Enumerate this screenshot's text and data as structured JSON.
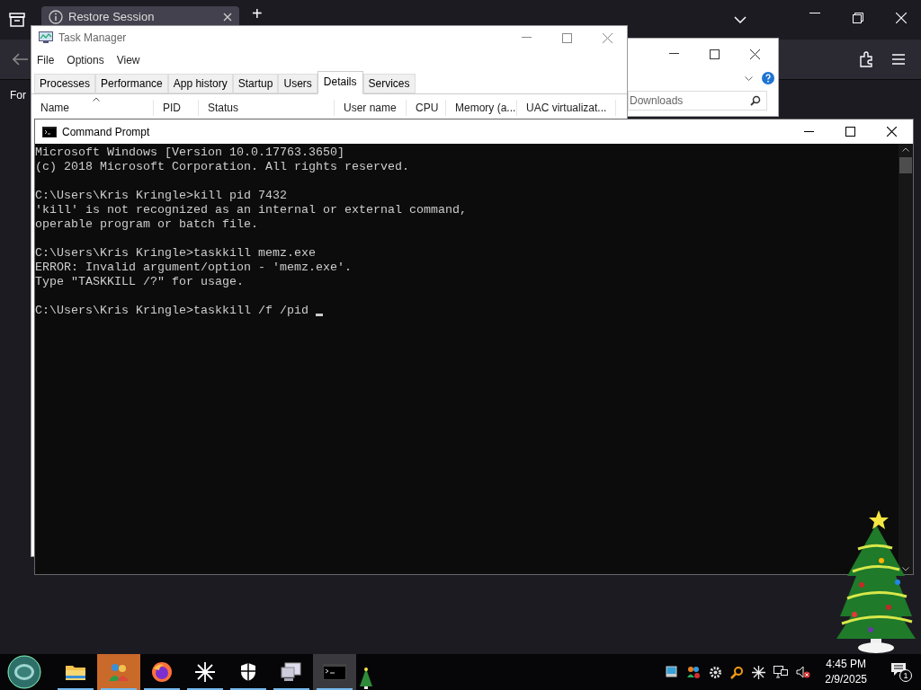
{
  "browser": {
    "tab": {
      "title": "Restore Session",
      "selected": true
    },
    "new_tab": "+",
    "page_text": "For"
  },
  "explorer": {
    "search": {
      "placeholder": "Downloads"
    }
  },
  "task_manager": {
    "title": "Task Manager",
    "menu": [
      "File",
      "Options",
      "View"
    ],
    "tabs": [
      {
        "label": "Processes",
        "selected": false
      },
      {
        "label": "Performance",
        "selected": false
      },
      {
        "label": "App history",
        "selected": false
      },
      {
        "label": "Startup",
        "selected": false
      },
      {
        "label": "Users",
        "selected": false
      },
      {
        "label": "Details",
        "selected": true
      },
      {
        "label": "Services",
        "selected": false
      }
    ],
    "columns": [
      "Name",
      "PID",
      "Status",
      "User name",
      "CPU",
      "Memory (a...",
      "UAC virtualizat..."
    ]
  },
  "command_prompt": {
    "title": "Command Prompt",
    "cursor": true,
    "blocks": [
      [
        "Microsoft Windows [Version 10.0.17763.3650]",
        "(c) 2018 Microsoft Corporation. All rights reserved."
      ],
      [
        "C:\\Users\\Kris Kringle>kill pid 7432",
        "'kill' is not recognized as an internal or external command,",
        "operable program or batch file."
      ],
      [
        "C:\\Users\\Kris Kringle>taskkill memz.exe",
        "ERROR: Invalid argument/option - 'memz.exe'.",
        "Type \"TASKKILL /?\" for usage."
      ],
      [
        "C:\\Users\\Kris Kringle>taskkill /f /pid "
      ]
    ]
  },
  "taskbar": {
    "items": [
      {
        "kind": "folder",
        "selected": false
      },
      {
        "kind": "people",
        "selected": true
      },
      {
        "kind": "firefox",
        "selected": false
      },
      {
        "kind": "asterisk",
        "selected": false
      },
      {
        "kind": "shield",
        "selected": false
      },
      {
        "kind": "computer",
        "selected": false
      },
      {
        "kind": "terminal",
        "selected": true
      }
    ],
    "time": "4:45 PM",
    "date": "2/9/2025",
    "notifications": "1"
  }
}
